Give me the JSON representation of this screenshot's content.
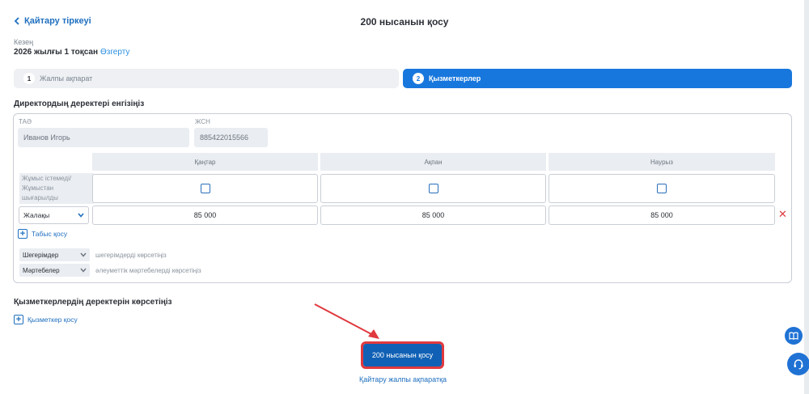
{
  "header": {
    "back_label": "Қайтару тіркеуі",
    "title": "200 нысанын қосу"
  },
  "period": {
    "label": "Кезең",
    "value": "2026 жылғы 1 тоқсан",
    "change_label": "Өзгерту"
  },
  "steps": [
    {
      "num": "1",
      "label": "Жалпы ақпарат",
      "active": false
    },
    {
      "num": "2",
      "label": "Қызметкерлер",
      "active": true
    }
  ],
  "director": {
    "section_title": "Директордың деректері енгізіңіз",
    "name_label": "ТАӘ",
    "name_value": "Иванов Игорь",
    "iin_label": "ЖСН",
    "iin_value": "885422015566",
    "months": [
      "Қаңтар",
      "Ақпан",
      "Наурыз"
    ],
    "status_label": "Жұмыс істемеді/ Жұмыстан шығарылды",
    "income_type": "Жалақы",
    "income_values": [
      "85 000",
      "85 000",
      "85 000"
    ],
    "add_income_label": "Табыс қосу",
    "deductions_select": "Шегерімдер",
    "deductions_hint": "шегерімдерді көрсетіңіз",
    "statuses_select": "Мәртебелер",
    "statuses_hint": "әлеуметтік мәртебелерді көрсетіңіз"
  },
  "employees": {
    "section_title": "Қызметкерлердің деректерін көрсетіңіз",
    "add_label": "Қызметкер қосу"
  },
  "footer": {
    "submit_label": "200 нысанын қосу",
    "back_general_label": "Қайтару жалпы ақпаратқа"
  },
  "colors": {
    "accent": "#1877dd",
    "highlight": "#e0393e",
    "submit": "#1061b5"
  },
  "icons": [
    "chevron-left-icon",
    "chevron-down-icon",
    "plus-icon",
    "close-icon",
    "book-icon",
    "headset-icon",
    "arrow-annotation"
  ]
}
